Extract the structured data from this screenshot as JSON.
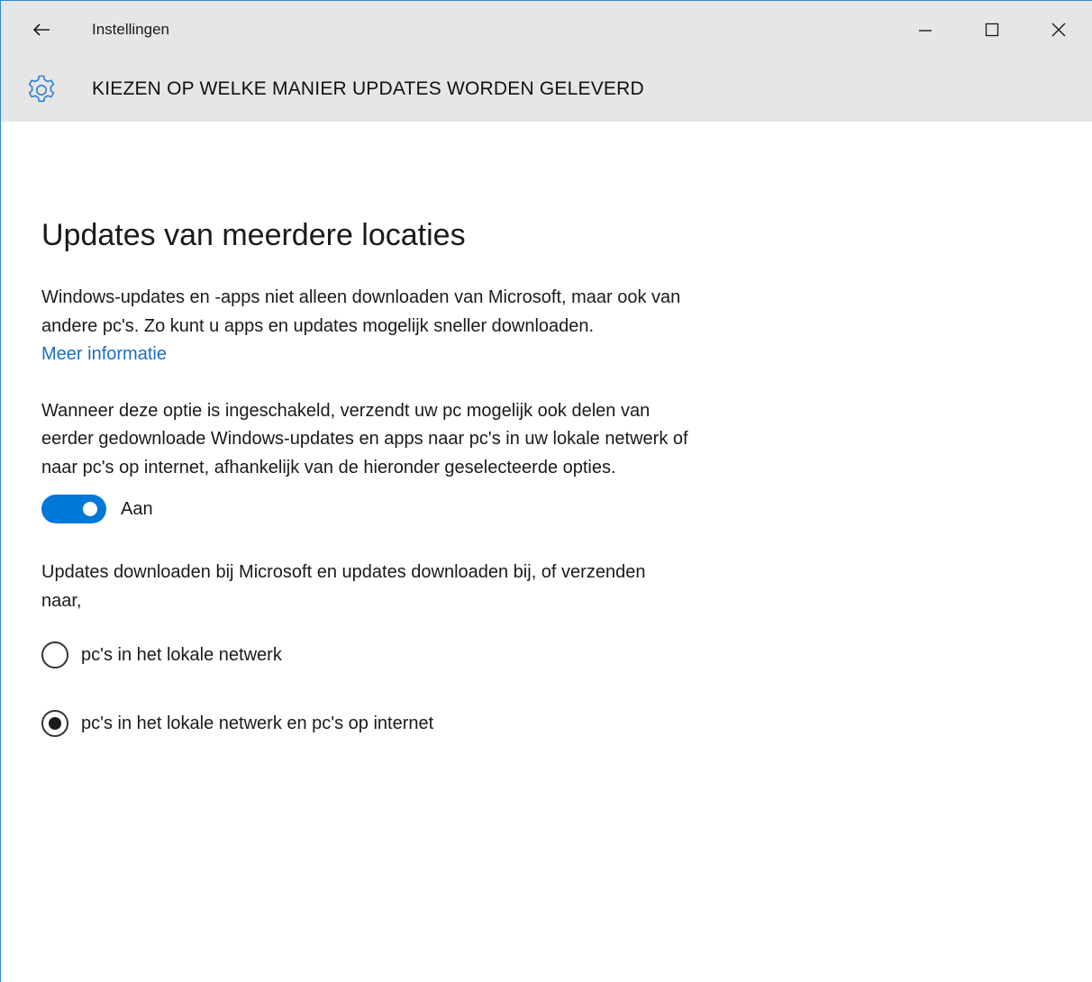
{
  "window": {
    "app_title": "Instellingen",
    "accent_color": "#0078d7",
    "link_color": "#1a6fbf",
    "titlebar_color": "#e6e6e6"
  },
  "titlebar": {
    "back_icon": "back-arrow-icon",
    "controls": [
      "minimize-icon",
      "maximize-icon",
      "close-icon"
    ]
  },
  "header": {
    "icon": "gear-icon",
    "title": "KIEZEN OP WELKE MANIER UPDATES WORDEN GELEVERD"
  },
  "section": {
    "title": "Updates van meerdere locaties",
    "intro": "Windows-updates en -apps niet alleen downloaden van Microsoft, maar ook van andere pc's. Zo kunt u apps en updates mogelijk sneller downloaden.",
    "more_info_link": "Meer informatie",
    "description": "Wanneer deze optie is ingeschakeld, verzendt uw pc mogelijk ook delen van eerder gedownloade Windows-updates en apps naar pc's in uw lokale netwerk of naar pc's op internet, afhankelijk van de hieronder geselecteerde opties.",
    "toggle": {
      "state": "on",
      "label": "Aan"
    },
    "download_from_text": "Updates downloaden bij Microsoft en updates downloaden bij, of verzenden naar,",
    "options": [
      {
        "label": "pc's in het lokale netwerk",
        "selected": false
      },
      {
        "label": "pc's in het lokale netwerk en pc's op internet",
        "selected": true
      }
    ]
  }
}
